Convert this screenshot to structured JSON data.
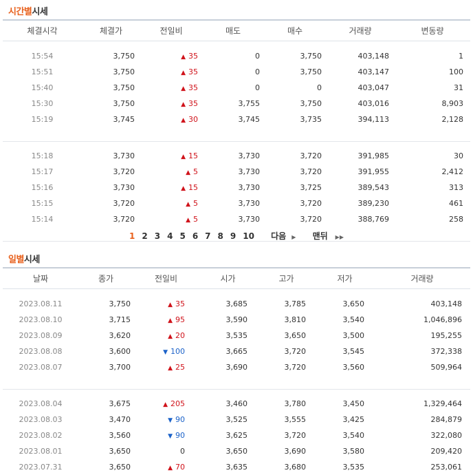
{
  "time_section": {
    "title_highlight": "시간별",
    "title_rest": "시세",
    "headers": [
      "체결시각",
      "체결가",
      "전일비",
      "매도",
      "매수",
      "거래량",
      "변동량"
    ],
    "groups": [
      [
        {
          "time": "15:54",
          "price": "3,750",
          "dir": "up",
          "change": "35",
          "ask": "0",
          "bid": "3,750",
          "volume": "403,148",
          "delta": "1"
        },
        {
          "time": "15:51",
          "price": "3,750",
          "dir": "up",
          "change": "35",
          "ask": "0",
          "bid": "3,750",
          "volume": "403,147",
          "delta": "100"
        },
        {
          "time": "15:40",
          "price": "3,750",
          "dir": "up",
          "change": "35",
          "ask": "0",
          "bid": "0",
          "volume": "403,047",
          "delta": "31"
        },
        {
          "time": "15:30",
          "price": "3,750",
          "dir": "up",
          "change": "35",
          "ask": "3,755",
          "bid": "3,750",
          "volume": "403,016",
          "delta": "8,903"
        },
        {
          "time": "15:19",
          "price": "3,745",
          "dir": "up",
          "change": "30",
          "ask": "3,745",
          "bid": "3,735",
          "volume": "394,113",
          "delta": "2,128"
        }
      ],
      [
        {
          "time": "15:18",
          "price": "3,730",
          "dir": "up",
          "change": "15",
          "ask": "3,730",
          "bid": "3,720",
          "volume": "391,985",
          "delta": "30"
        },
        {
          "time": "15:17",
          "price": "3,720",
          "dir": "up",
          "change": "5",
          "ask": "3,730",
          "bid": "3,720",
          "volume": "391,955",
          "delta": "2,412"
        },
        {
          "time": "15:16",
          "price": "3,730",
          "dir": "up",
          "change": "15",
          "ask": "3,730",
          "bid": "3,725",
          "volume": "389,543",
          "delta": "313"
        },
        {
          "time": "15:15",
          "price": "3,720",
          "dir": "up",
          "change": "5",
          "ask": "3,730",
          "bid": "3,720",
          "volume": "389,230",
          "delta": "461"
        },
        {
          "time": "15:14",
          "price": "3,720",
          "dir": "up",
          "change": "5",
          "ask": "3,730",
          "bid": "3,720",
          "volume": "388,769",
          "delta": "258"
        }
      ]
    ]
  },
  "pager": {
    "pages": [
      "1",
      "2",
      "3",
      "4",
      "5",
      "6",
      "7",
      "8",
      "9",
      "10"
    ],
    "current": "1",
    "next_label": "다음",
    "last_label": "맨뒤",
    "next_arrow": "▶",
    "last_arrow": "▶▶"
  },
  "day_section": {
    "title_highlight": "일별",
    "title_rest": "시세",
    "headers": [
      "날짜",
      "종가",
      "전일비",
      "시가",
      "고가",
      "저가",
      "거래량"
    ],
    "groups": [
      [
        {
          "date": "2023.08.11",
          "close": "3,750",
          "dir": "up",
          "change": "35",
          "open": "3,685",
          "high": "3,785",
          "low": "3,650",
          "volume": "403,148"
        },
        {
          "date": "2023.08.10",
          "close": "3,715",
          "dir": "up",
          "change": "95",
          "open": "3,590",
          "high": "3,810",
          "low": "3,540",
          "volume": "1,046,896"
        },
        {
          "date": "2023.08.09",
          "close": "3,620",
          "dir": "up",
          "change": "20",
          "open": "3,535",
          "high": "3,650",
          "low": "3,500",
          "volume": "195,255"
        },
        {
          "date": "2023.08.08",
          "close": "3,600",
          "dir": "down",
          "change": "100",
          "open": "3,665",
          "high": "3,720",
          "low": "3,545",
          "volume": "372,338"
        },
        {
          "date": "2023.08.07",
          "close": "3,700",
          "dir": "up",
          "change": "25",
          "open": "3,690",
          "high": "3,720",
          "low": "3,560",
          "volume": "509,964"
        }
      ],
      [
        {
          "date": "2023.08.04",
          "close": "3,675",
          "dir": "up",
          "change": "205",
          "open": "3,460",
          "high": "3,780",
          "low": "3,450",
          "volume": "1,329,464"
        },
        {
          "date": "2023.08.03",
          "close": "3,470",
          "dir": "down",
          "change": "90",
          "open": "3,525",
          "high": "3,555",
          "low": "3,425",
          "volume": "284,879"
        },
        {
          "date": "2023.08.02",
          "close": "3,560",
          "dir": "down",
          "change": "90",
          "open": "3,625",
          "high": "3,720",
          "low": "3,540",
          "volume": "322,080"
        },
        {
          "date": "2023.08.01",
          "close": "3,650",
          "dir": "flat",
          "change": "0",
          "open": "3,650",
          "high": "3,690",
          "low": "3,580",
          "volume": "209,420"
        },
        {
          "date": "2023.07.31",
          "close": "3,650",
          "dir": "up",
          "change": "70",
          "open": "3,635",
          "high": "3,680",
          "low": "3,535",
          "volume": "253,061"
        }
      ]
    ]
  },
  "symbols": {
    "up": "▲",
    "down": "▼",
    "flat": ""
  },
  "colors": {
    "accent": "#e8601c",
    "up": "#d0131b",
    "down": "#1b62c9"
  }
}
